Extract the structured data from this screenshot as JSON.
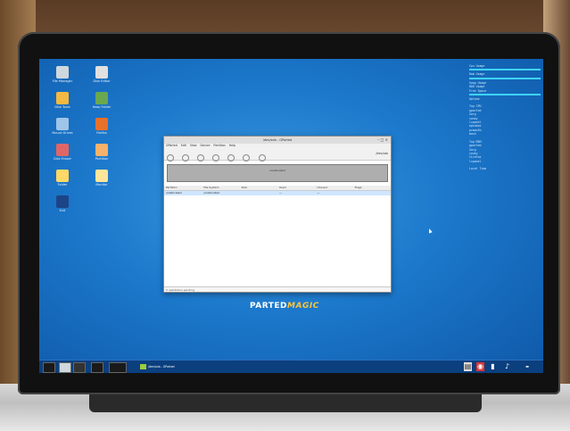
{
  "desktop": {
    "icons": [
      {
        "label": "File Manager",
        "icon": "folder-icon",
        "color": "#cfd8dc"
      },
      {
        "label": "Disk Editor",
        "icon": "computer-icon",
        "color": "#e0e0e0"
      },
      {
        "label": "Disk Tools",
        "icon": "tools-icon",
        "color": "#f4b942"
      },
      {
        "label": "Keep Folder",
        "icon": "drive-icon",
        "color": "#6aa84f"
      },
      {
        "label": "Mount Drives",
        "icon": "monitor-icon",
        "color": "#9fc5e8"
      },
      {
        "label": "Firefox",
        "icon": "firefox-icon",
        "color": "#e8702a"
      },
      {
        "label": "Disk Eraser",
        "icon": "eraser-icon",
        "color": "#e06666"
      },
      {
        "label": "Partition",
        "icon": "partition-icon",
        "color": "#f6b26b"
      },
      {
        "label": "Folder",
        "icon": "folder-icon",
        "color": "#ffd966"
      },
      {
        "label": "Monitor",
        "icon": "battery-icon",
        "color": "#ffe599"
      },
      {
        "label": "Exit",
        "icon": "power-icon",
        "color": "#1c4587"
      }
    ]
  },
  "conky": {
    "lines1": [
      "Cpu Usage",
      "",
      "Ram Usage",
      "",
      "Swap Usage",
      "HDD Usage",
      "Free Space",
      "",
      "Uptime"
    ],
    "section_title": "Top CPU",
    "proc_lines": [
      "gparted",
      "Xorg",
      "conky",
      "lxpanel",
      "openbox",
      "pcmanfm",
      "bash"
    ],
    "section2_title": "Top MEM",
    "proc_lines2": [
      "gparted",
      "Xorg",
      "conky",
      "firefox",
      "lxpanel"
    ],
    "footer": "Local Time"
  },
  "gparted": {
    "title": "/dev/sda - GParted",
    "menu": [
      "GParted",
      "Edit",
      "View",
      "Device",
      "Partition",
      "Help"
    ],
    "device": "/dev/sda",
    "disk_label": "unallocated",
    "columns": [
      "Partition",
      "File System",
      "Size",
      "Used",
      "Unused",
      "Flags"
    ],
    "row": [
      "unallocated",
      "unallocated",
      "",
      "---",
      "---",
      ""
    ],
    "status": "0 operations pending"
  },
  "brand": {
    "part1": "PARTED",
    "part2": "MAGIC"
  },
  "taskbar": {
    "task": "/dev/sda - GParted"
  }
}
